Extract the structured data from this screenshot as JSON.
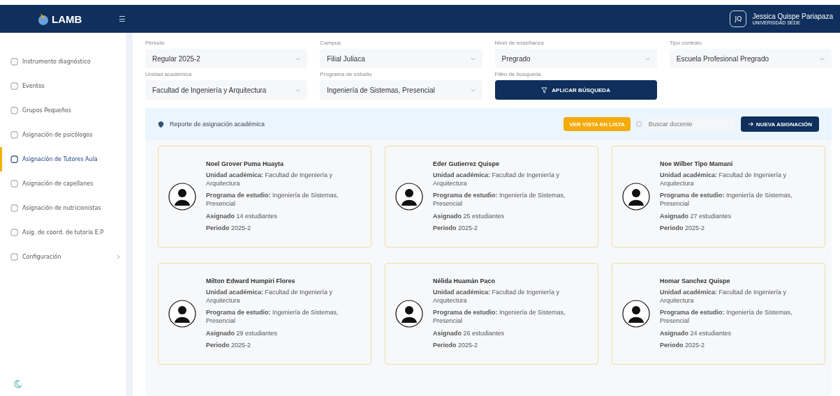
{
  "header": {
    "logo": "LAMB",
    "menu_icon": "☰",
    "user": {
      "initials": "JQ",
      "name": "Jessica Quispe Pariapaza",
      "org": "UNIVERSIDAD SEDE"
    }
  },
  "sidebar": {
    "items": [
      {
        "label": "Instrumento diagnóstico",
        "selected": false
      },
      {
        "label": "Eventos",
        "selected": false
      },
      {
        "label": "Grupos Pequeños",
        "selected": false
      },
      {
        "label": "Asignación de psicólogos",
        "selected": false
      },
      {
        "label": "Asignación de Tutores Aula",
        "selected": true
      },
      {
        "label": "Asignación de capellanes",
        "selected": false
      },
      {
        "label": "Asignación de nutricionistas",
        "selected": false
      },
      {
        "label": "Asig. de coord. de tutoría E.P",
        "selected": false
      },
      {
        "label": "Configuración",
        "selected": false,
        "expandable": true
      }
    ]
  },
  "filters": [
    {
      "label": "Periodo",
      "value": "Regular 2025-2"
    },
    {
      "label": "Campus",
      "value": "Filial Juliaca"
    },
    {
      "label": "Nivel de enseñanza",
      "value": "Pregrado"
    },
    {
      "label": "Tipo contrato",
      "value": "Escuela Profesional Pregrado"
    },
    {
      "label": "Unidad académica",
      "value": "Facultad de Ingeniería y Arquitectura"
    },
    {
      "label": "Programa de estudio",
      "value": "Ingeniería de Sistemas, Presencial"
    }
  ],
  "search_filter": {
    "label": "Filtro de búsqueda",
    "button": "APLICAR BÚSQUEDA"
  },
  "report": {
    "title": "Reporte de asignación académica",
    "list_button": "VER VISTA EN LISTA",
    "search_placeholder": "Buscar docente",
    "new_button": "NUEVA ASIGNACIÓN"
  },
  "cards": [
    {
      "name": "Noel Grover Puma Huayta",
      "unidad": "**Unidad académica:** Facultad de Ingeniería y Arquitectura",
      "programa": "**Programa de estudio:** Ingeniería de Sistemas, Presencial",
      "asignado": "**Asignado** 14 estudiantes",
      "periodo": "**Periodo** 2025-2"
    },
    {
      "name": "Eder Gutierrez Quispe",
      "unidad": "**Unidad académica:** Facultad de Ingeniería y Arquitectura",
      "programa": "**Programa de estudio:** Ingeniería de Sistemas, Presencial",
      "asignado": "**Asignado** 25 estudiantes",
      "periodo": "**Periodo** 2025-2"
    },
    {
      "name": "Noe Wilber Tipo Mamani",
      "unidad": "**Unidad académica:** Facultad de Ingeniería y Arquitectura",
      "programa": "**Programa de estudio:** Ingeniería de Sistemas, Presencial",
      "asignado": "**Asignado** 27 estudiantes",
      "periodo": "**Periodo** 2025-2"
    },
    {
      "name": "Milton Edward Humpiri Flores",
      "unidad": "**Unidad académica:** Facultad de Ingeniería y Arquitectura",
      "programa": "**Programa de estudio:** Ingeniería de Sistemas, Presencial",
      "asignado": "**Asignado** 29 estudiantes",
      "periodo": "**Periodo** 2025-2"
    },
    {
      "name": "Nélida Huamán Paco",
      "unidad": "**Unidad académica:** Facultad de Ingeniería y Arquitectura",
      "programa": "**Programa de estudio:** Ingeniería de Sistemas, Presencial",
      "asignado": "**Asignado** 26 estudiantes",
      "periodo": "**Periodo** 2025-2"
    },
    {
      "name": "Homar Sanchez Quispe",
      "unidad": "**Unidad académica:** Facultad de Ingeniería y Arquitectura",
      "programa": "**Programa de estudio:** Ingeniería de Sistemas, Presencial",
      "asignado": "**Asignado** 24 estudiantes",
      "periodo": "**Periodo** 2025-2"
    }
  ]
}
